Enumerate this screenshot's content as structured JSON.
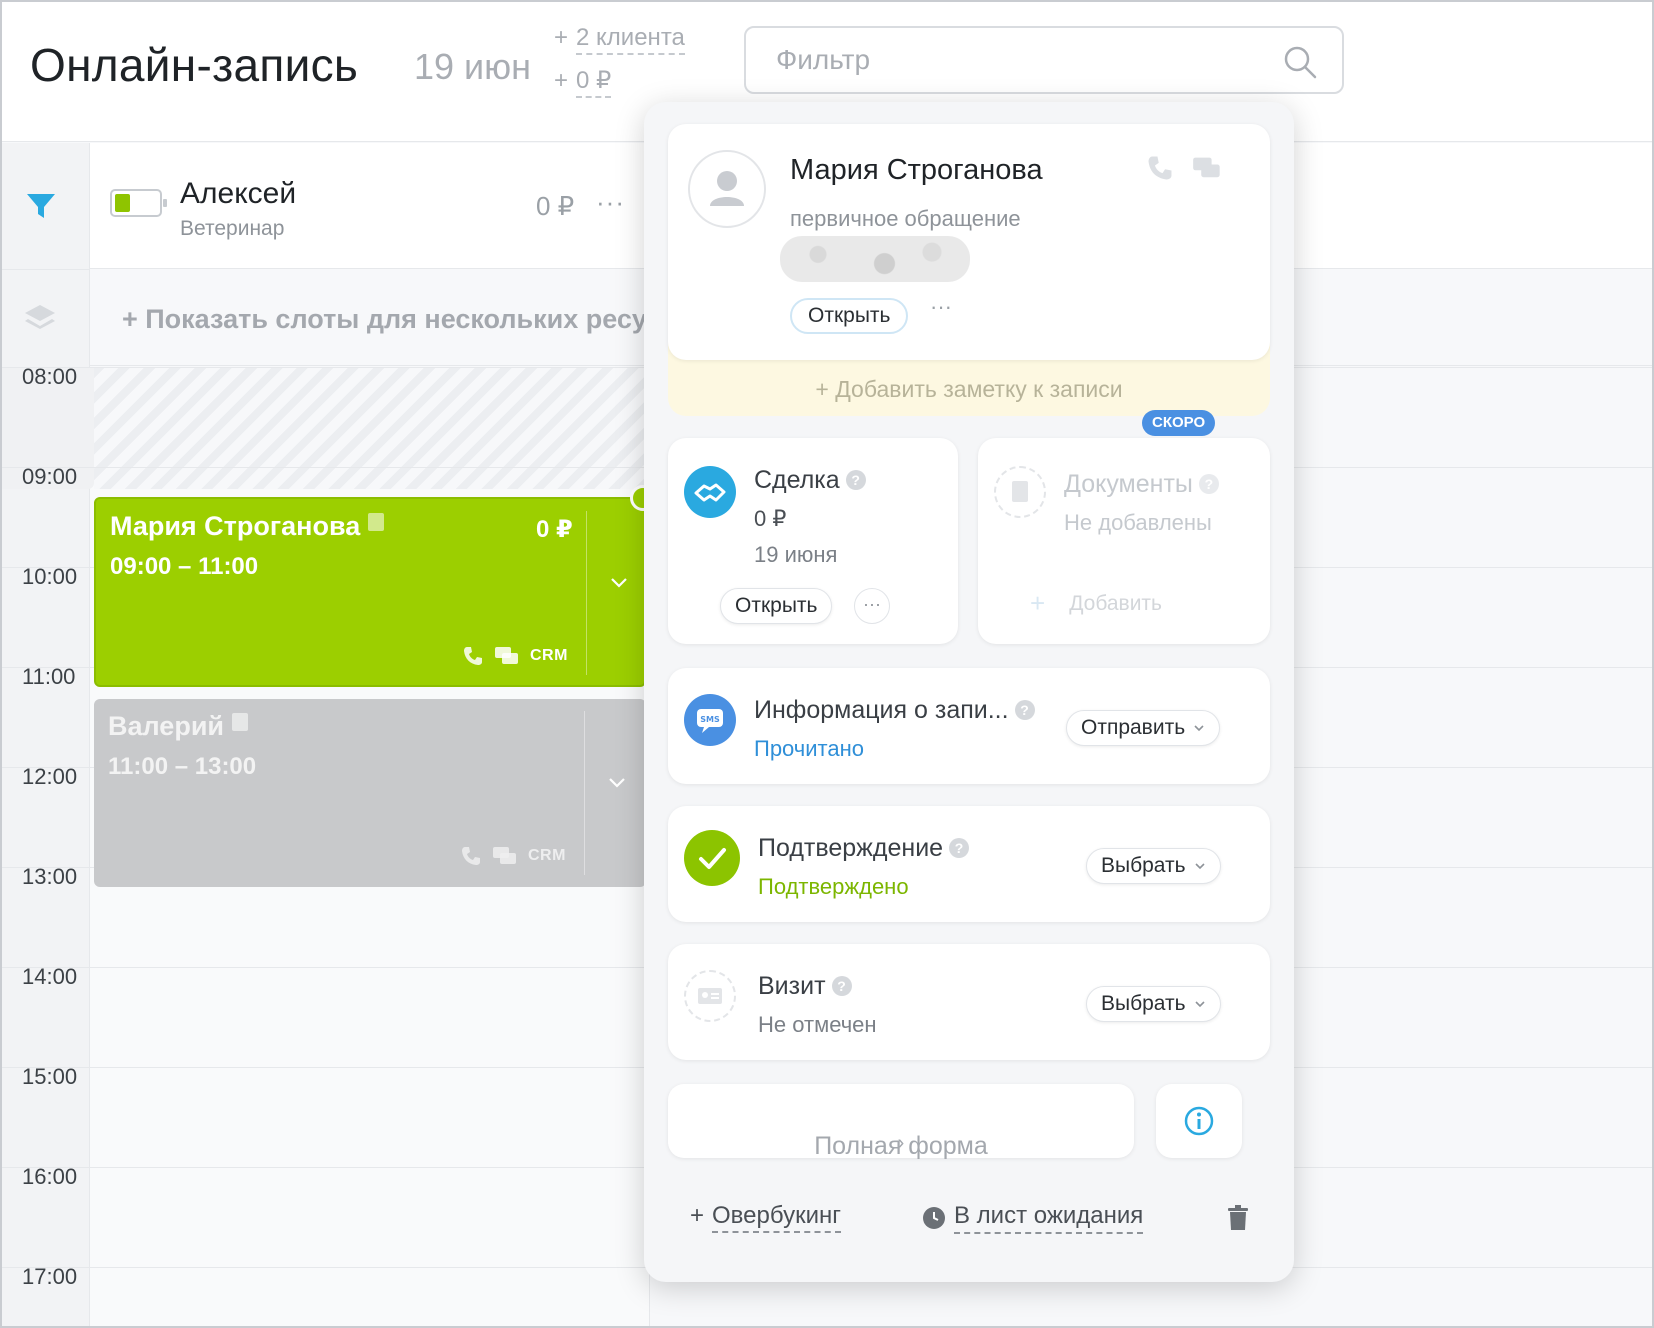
{
  "header": {
    "title": "Онлайн-запись",
    "date": "19 июн",
    "clients_stat": "2 клиента",
    "money_stat": "0 ₽",
    "stat_prefix": "+",
    "filter_placeholder": "Фильтр"
  },
  "resource": {
    "name": "Алексей",
    "role": "Ветеринар",
    "money": "0 ₽",
    "more": "···",
    "battery_level": 0.35
  },
  "slots_link": "+ Показать слоты для нескольких ресурсов",
  "hours": [
    "08:00",
    "09:00",
    "10:00",
    "11:00",
    "12:00",
    "13:00",
    "14:00",
    "15:00",
    "16:00",
    "17:00"
  ],
  "appointments": [
    {
      "name": "Мария Строганова",
      "time": "09:00 – 11:00",
      "price": "0 ₽",
      "crm": "CRM",
      "color": "#9ccf00"
    },
    {
      "name": "Валерий",
      "time": "11:00 – 13:00",
      "price": "",
      "crm": "CRM",
      "color": "#c8c9cb"
    }
  ],
  "popup": {
    "client": {
      "name": "Мария Строганова",
      "subtitle": "первичное обращение",
      "open_label": "Открыть",
      "more": "···"
    },
    "note_label": "+ Добавить заметку к записи",
    "deal": {
      "title": "Сделка",
      "amount": "0 ₽",
      "date": "19 июня",
      "open_label": "Открыть",
      "more": "···"
    },
    "documents": {
      "badge": "СКОРО",
      "title": "Документы",
      "status": "Не добавлены",
      "add_label": "Добавить"
    },
    "info": {
      "title": "Информация о запи...",
      "status": "Прочитано",
      "button": "Отправить"
    },
    "confirmation": {
      "title": "Подтверждение",
      "status": "Подтверждено",
      "button": "Выбрать"
    },
    "visit": {
      "title": "Визит",
      "status": "Не отмечен",
      "button": "Выбрать"
    },
    "full_form": "Полная форма",
    "overbooking": "Овербукинг",
    "waitlist": "В лист ожидания"
  },
  "colors": {
    "accent_blue": "#2aa9e0",
    "green": "#9ccf00",
    "confirmed_text": "#7cb600",
    "read_text": "#2f8fd8"
  }
}
